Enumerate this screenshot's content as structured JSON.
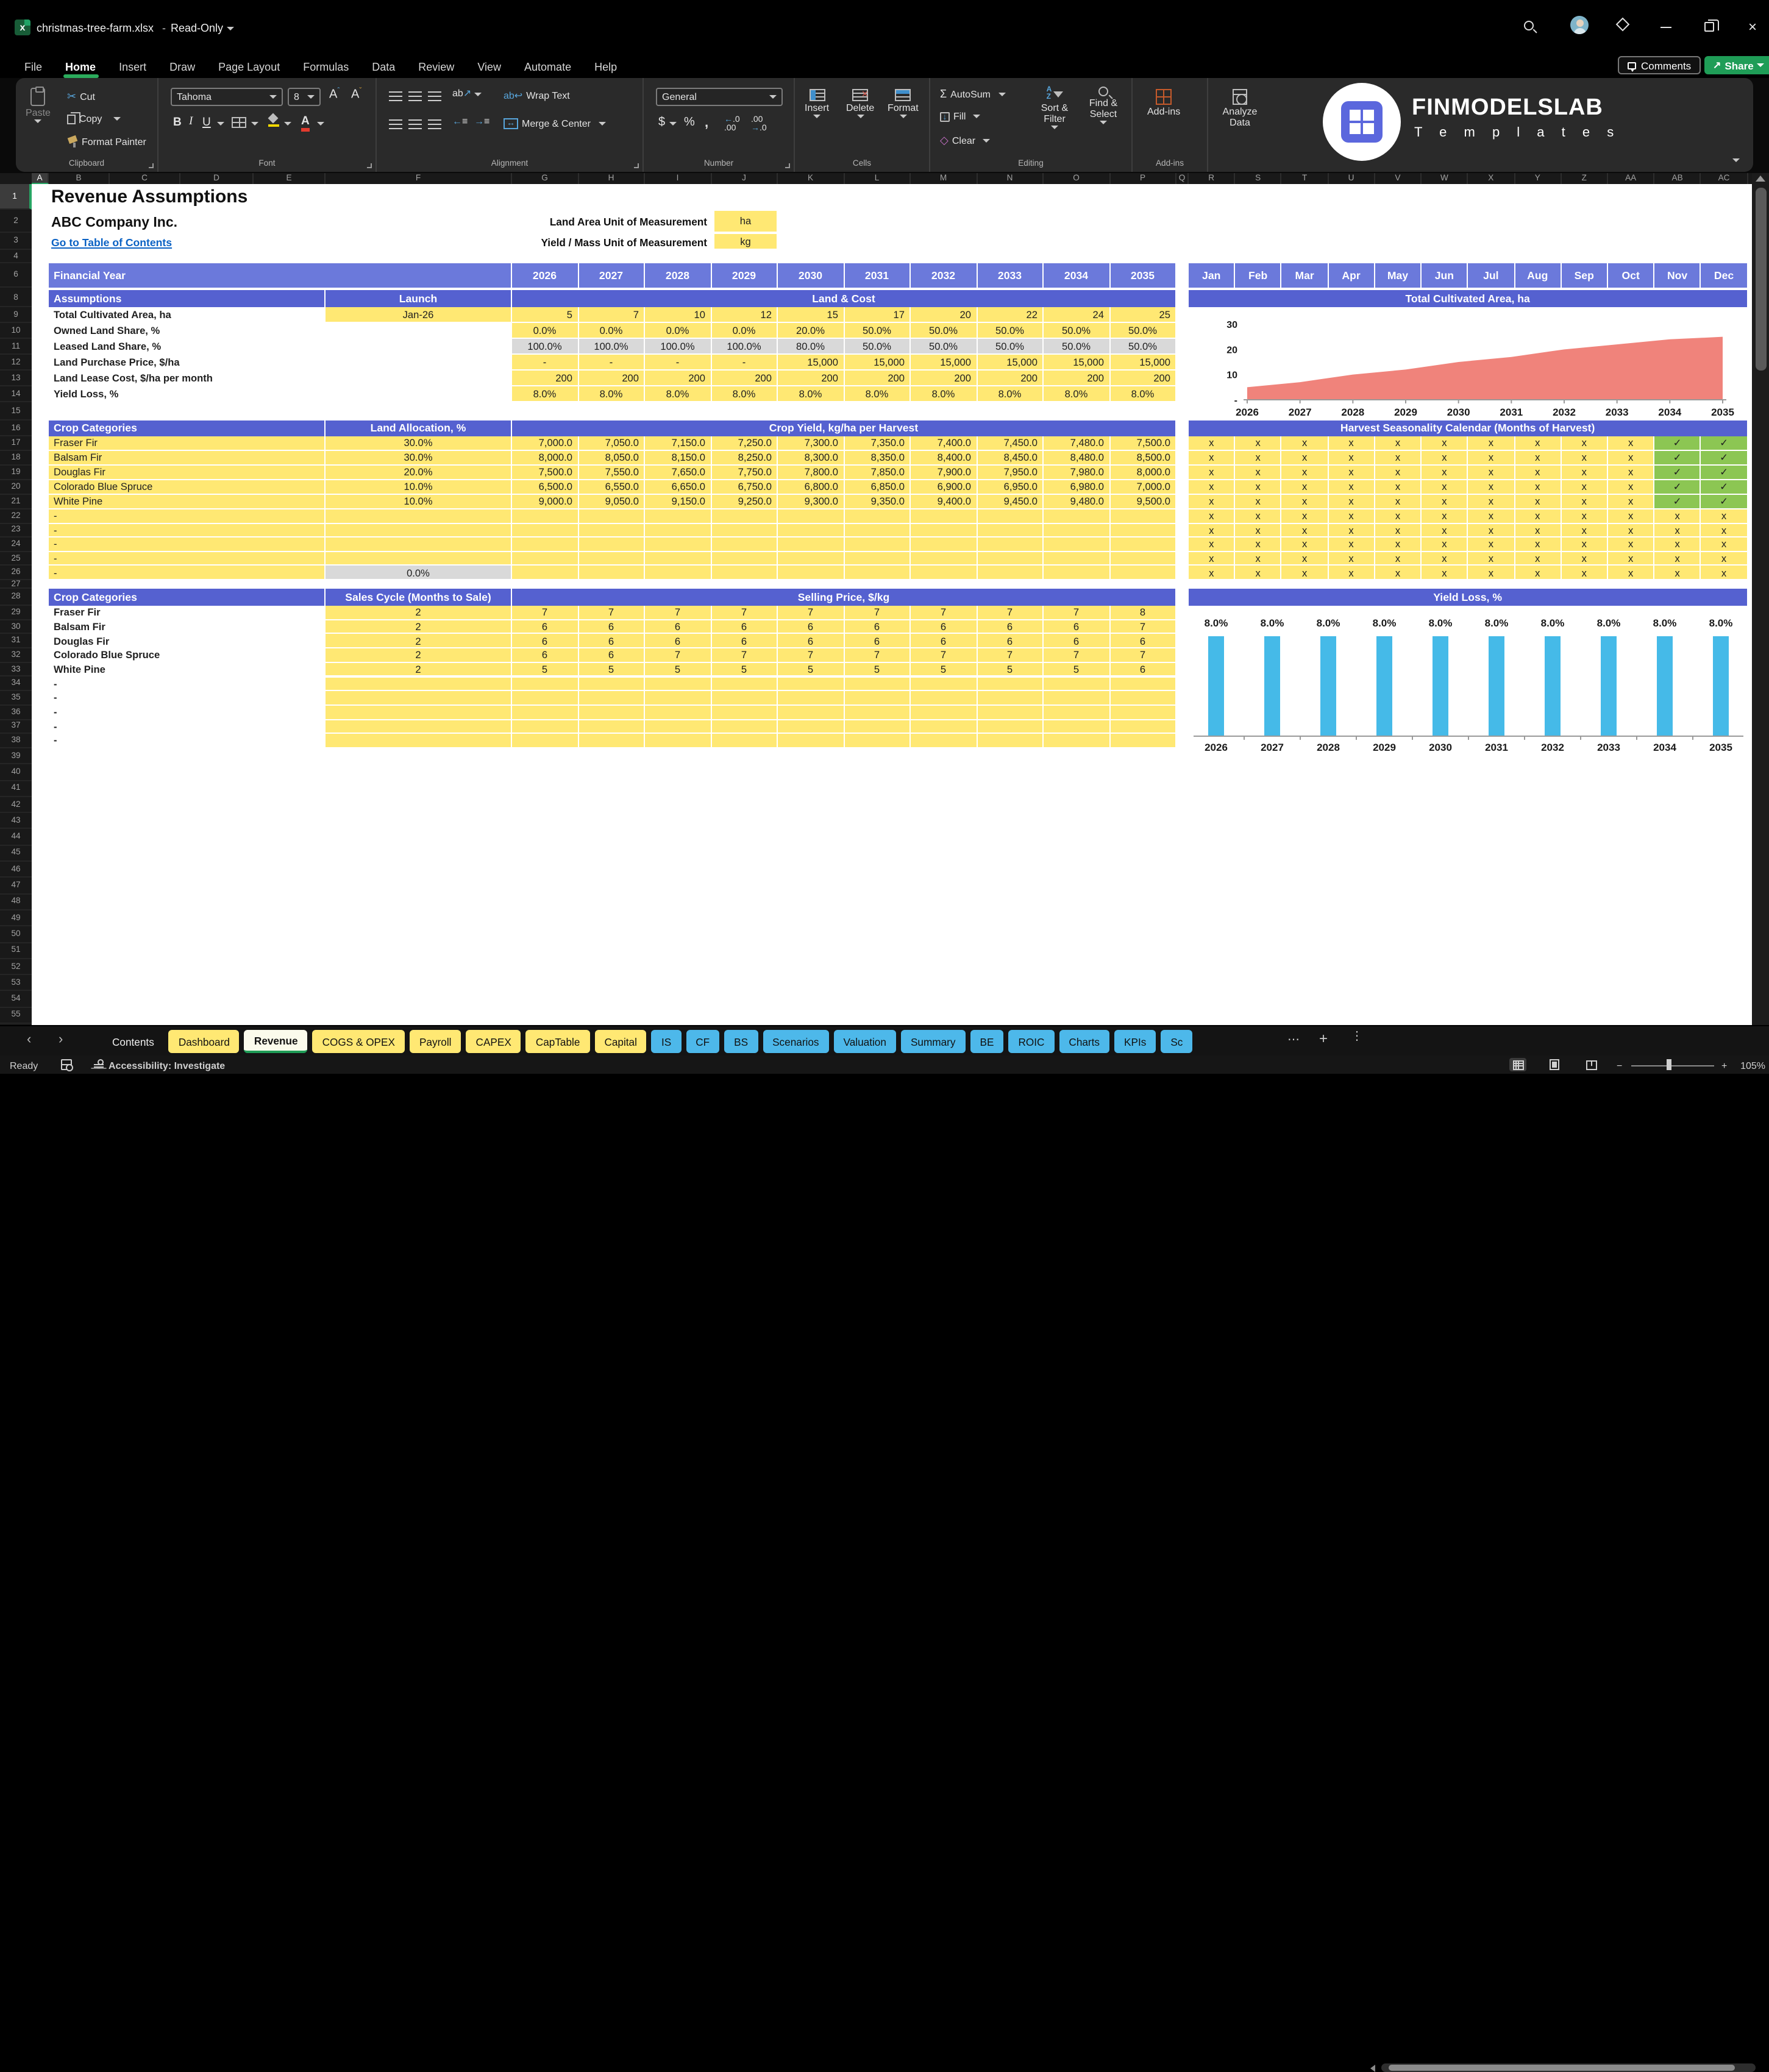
{
  "titlebar": {
    "file": "christmas-tree-farm.xlsx",
    "sep": "-",
    "mode": "Read-Only"
  },
  "topbar": {
    "comments": "Comments",
    "share": "Share"
  },
  "menu": [
    "File",
    "Home",
    "Insert",
    "Draw",
    "Page Layout",
    "Formulas",
    "Data",
    "Review",
    "View",
    "Automate",
    "Help"
  ],
  "active_menu": "Home",
  "ribbon": {
    "paste": "Paste",
    "cut": "Cut",
    "copy": "Copy",
    "format_painter": "Format Painter",
    "clipboard": "Clipboard",
    "font_name": "Tahoma",
    "font_size": "8",
    "font": "Font",
    "wrap_text": "Wrap Text",
    "merge_center": "Merge & Center",
    "alignment": "Alignment",
    "number_format": "General",
    "number": "Number",
    "insert": "Insert",
    "delete": "Delete",
    "format": "Format",
    "cells": "Cells",
    "autosum": "AutoSum",
    "fill": "Fill",
    "clear": "Clear",
    "sort_filter": "Sort & Filter",
    "find_select": "Find & Select",
    "editing": "Editing",
    "addins": "Add-ins",
    "addins_group": "Add-ins",
    "analyze_data": "Analyze Data"
  },
  "logo": {
    "name": "FINMODELSLAB",
    "sub": "T e m p l a t e s"
  },
  "grid": {
    "columns": [
      "A",
      "B",
      "C",
      "D",
      "E",
      "F",
      "G",
      "H",
      "I",
      "J",
      "K",
      "L",
      "M",
      "N",
      "O",
      "P",
      "Q",
      "R",
      "S",
      "T",
      "U",
      "V",
      "W",
      "X",
      "Y",
      "Z",
      "AA",
      "AB",
      "AC"
    ],
    "rows": [
      "1",
      "2",
      "3",
      "4",
      "6",
      "8",
      "9",
      "10",
      "11",
      "12",
      "13",
      "14",
      "15",
      "16",
      "17",
      "18",
      "19",
      "20",
      "21",
      "22",
      "23",
      "24",
      "25",
      "26",
      "27",
      "28",
      "29",
      "30",
      "31",
      "32",
      "33",
      "34",
      "35",
      "36",
      "37",
      "38",
      "39",
      "40",
      "41",
      "42",
      "43",
      "44",
      "45",
      "46",
      "47",
      "48",
      "49",
      "50",
      "51",
      "52",
      "53",
      "54",
      "55"
    ]
  },
  "sheet": {
    "title": "Revenue Assumptions",
    "company": "ABC Company Inc.",
    "toc_link": "Go to Table of Contents",
    "uom": [
      {
        "label": "Land Area Unit of Measurement",
        "value": "ha"
      },
      {
        "label": "Yield / Mass Unit of Measurement",
        "value": "kg"
      }
    ],
    "financial_year": {
      "label": "Financial Year",
      "years": [
        "2026",
        "2027",
        "2028",
        "2029",
        "2030",
        "2031",
        "2032",
        "2033",
        "2034",
        "2035"
      ]
    },
    "months": [
      "Jan",
      "Feb",
      "Mar",
      "Apr",
      "May",
      "Jun",
      "Jul",
      "Aug",
      "Sep",
      "Oct",
      "Nov",
      "Dec"
    ],
    "assumptions": {
      "title": "Assumptions",
      "launch": "Launch",
      "group": "Land & Cost",
      "rows": [
        {
          "label": "Total Cultivated Area, ha",
          "launch": "Jan-26",
          "align": "right",
          "values": [
            "5",
            "7",
            "10",
            "12",
            "15",
            "17",
            "20",
            "22",
            "24",
            "25"
          ]
        },
        {
          "label": "Owned Land Share, %",
          "align": "center",
          "values": [
            "0.0%",
            "0.0%",
            "0.0%",
            "0.0%",
            "20.0%",
            "50.0%",
            "50.0%",
            "50.0%",
            "50.0%",
            "50.0%"
          ]
        },
        {
          "label": "Leased Land Share, %",
          "align": "center",
          "grey": true,
          "values": [
            "100.0%",
            "100.0%",
            "100.0%",
            "100.0%",
            "80.0%",
            "50.0%",
            "50.0%",
            "50.0%",
            "50.0%",
            "50.0%"
          ]
        },
        {
          "label": "Land Purchase Price, $/ha",
          "align": "right",
          "values": [
            "-",
            "-",
            "-",
            "-",
            "15,000",
            "15,000",
            "15,000",
            "15,000",
            "15,000",
            "15,000"
          ]
        },
        {
          "label": "Land Lease Cost, $/ha per month",
          "align": "right",
          "values": [
            "200",
            "200",
            "200",
            "200",
            "200",
            "200",
            "200",
            "200",
            "200",
            "200"
          ]
        },
        {
          "label": "Yield Loss, %",
          "align": "center",
          "values": [
            "8.0%",
            "8.0%",
            "8.0%",
            "8.0%",
            "8.0%",
            "8.0%",
            "8.0%",
            "8.0%",
            "8.0%",
            "8.0%"
          ]
        }
      ]
    },
    "crop_yield": {
      "title": "Crop Categories",
      "col2": "Land Allocation, %",
      "group": "Crop Yield, kg/ha per Harvest",
      "rows": [
        {
          "label": "Fraser Fir",
          "col2": "30.0%",
          "values": [
            "7,000.0",
            "7,050.0",
            "7,150.0",
            "7,250.0",
            "7,300.0",
            "7,350.0",
            "7,400.0",
            "7,450.0",
            "7,480.0",
            "7,500.0"
          ]
        },
        {
          "label": "Balsam Fir",
          "col2": "30.0%",
          "values": [
            "8,000.0",
            "8,050.0",
            "8,150.0",
            "8,250.0",
            "8,300.0",
            "8,350.0",
            "8,400.0",
            "8,450.0",
            "8,480.0",
            "8,500.0"
          ]
        },
        {
          "label": "Douglas Fir",
          "col2": "20.0%",
          "values": [
            "7,500.0",
            "7,550.0",
            "7,650.0",
            "7,750.0",
            "7,800.0",
            "7,850.0",
            "7,900.0",
            "7,950.0",
            "7,980.0",
            "8,000.0"
          ]
        },
        {
          "label": "Colorado Blue Spruce",
          "col2": "10.0%",
          "values": [
            "6,500.0",
            "6,550.0",
            "6,650.0",
            "6,750.0",
            "6,800.0",
            "6,850.0",
            "6,900.0",
            "6,950.0",
            "6,980.0",
            "7,000.0"
          ]
        },
        {
          "label": "White Pine",
          "col2": "10.0%",
          "values": [
            "9,000.0",
            "9,050.0",
            "9,150.0",
            "9,250.0",
            "9,300.0",
            "9,350.0",
            "9,400.0",
            "9,450.0",
            "9,480.0",
            "9,500.0"
          ]
        },
        {
          "label": "-",
          "col2": "",
          "values": [
            "",
            "",
            "",
            "",
            "",
            "",
            "",
            "",
            "",
            ""
          ]
        },
        {
          "label": "-",
          "col2": "",
          "values": [
            "",
            "",
            "",
            "",
            "",
            "",
            "",
            "",
            "",
            ""
          ]
        },
        {
          "label": "-",
          "col2": "",
          "values": [
            "",
            "",
            "",
            "",
            "",
            "",
            "",
            "",
            "",
            ""
          ]
        },
        {
          "label": "-",
          "col2": "",
          "values": [
            "",
            "",
            "",
            "",
            "",
            "",
            "",
            "",
            "",
            ""
          ]
        },
        {
          "label": "-",
          "col2": "0.0%",
          "col2_grey": true,
          "values": [
            "",
            "",
            "",
            "",
            "",
            "",
            "",
            "",
            "",
            ""
          ]
        }
      ]
    },
    "selling": {
      "title": "Crop Categories",
      "col2": "Sales Cycle (Months to Sale)",
      "group": "Selling Price, $/kg",
      "rows": [
        {
          "label": "Fraser Fir",
          "col2": "2",
          "values": [
            "7",
            "7",
            "7",
            "7",
            "7",
            "7",
            "7",
            "7",
            "7",
            "8"
          ]
        },
        {
          "label": "Balsam Fir",
          "col2": "2",
          "values": [
            "6",
            "6",
            "6",
            "6",
            "6",
            "6",
            "6",
            "6",
            "6",
            "7"
          ]
        },
        {
          "label": "Douglas Fir",
          "col2": "2",
          "values": [
            "6",
            "6",
            "6",
            "6",
            "6",
            "6",
            "6",
            "6",
            "6",
            "6"
          ]
        },
        {
          "label": "Colorado Blue Spruce",
          "col2": "2",
          "values": [
            "6",
            "6",
            "7",
            "7",
            "7",
            "7",
            "7",
            "7",
            "7",
            "7"
          ]
        },
        {
          "label": "White Pine",
          "col2": "2",
          "values": [
            "5",
            "5",
            "5",
            "5",
            "5",
            "5",
            "5",
            "5",
            "5",
            "6"
          ]
        },
        {
          "label": "-",
          "col2": "",
          "values": [
            "",
            "",
            "",
            "",
            "",
            "",
            "",
            "",
            "",
            ""
          ]
        },
        {
          "label": "-",
          "col2": "",
          "values": [
            "",
            "",
            "",
            "",
            "",
            "",
            "",
            "",
            "",
            ""
          ]
        },
        {
          "label": "-",
          "col2": "",
          "values": [
            "",
            "",
            "",
            "",
            "",
            "",
            "",
            "",
            "",
            ""
          ]
        },
        {
          "label": "-",
          "col2": "",
          "values": [
            "",
            "",
            "",
            "",
            "",
            "",
            "",
            "",
            "",
            ""
          ]
        },
        {
          "label": "-",
          "col2": "",
          "values": [
            "",
            "",
            "",
            "",
            "",
            "",
            "",
            "",
            "",
            ""
          ]
        }
      ]
    },
    "calendar": {
      "title": "Harvest Seasonality Calendar (Months of Harvest)",
      "rows": [
        [
          "x",
          "x",
          "x",
          "x",
          "x",
          "x",
          "x",
          "x",
          "x",
          "x",
          "✓",
          "✓"
        ],
        [
          "x",
          "x",
          "x",
          "x",
          "x",
          "x",
          "x",
          "x",
          "x",
          "x",
          "✓",
          "✓"
        ],
        [
          "x",
          "x",
          "x",
          "x",
          "x",
          "x",
          "x",
          "x",
          "x",
          "x",
          "✓",
          "✓"
        ],
        [
          "x",
          "x",
          "x",
          "x",
          "x",
          "x",
          "x",
          "x",
          "x",
          "x",
          "✓",
          "✓"
        ],
        [
          "x",
          "x",
          "x",
          "x",
          "x",
          "x",
          "x",
          "x",
          "x",
          "x",
          "✓",
          "✓"
        ],
        [
          "x",
          "x",
          "x",
          "x",
          "x",
          "x",
          "x",
          "x",
          "x",
          "x",
          "x",
          "x"
        ],
        [
          "x",
          "x",
          "x",
          "x",
          "x",
          "x",
          "x",
          "x",
          "x",
          "x",
          "x",
          "x"
        ],
        [
          "x",
          "x",
          "x",
          "x",
          "x",
          "x",
          "x",
          "x",
          "x",
          "x",
          "x",
          "x"
        ],
        [
          "x",
          "x",
          "x",
          "x",
          "x",
          "x",
          "x",
          "x",
          "x",
          "x",
          "x",
          "x"
        ],
        [
          "x",
          "x",
          "x",
          "x",
          "x",
          "x",
          "x",
          "x",
          "x",
          "x",
          "x",
          "x"
        ]
      ]
    }
  },
  "chart_data": [
    {
      "type": "area",
      "title": "Total Cultivated Area, ha",
      "x": [
        "2026",
        "2027",
        "2028",
        "2029",
        "2030",
        "2031",
        "2032",
        "2033",
        "2034",
        "2035"
      ],
      "values": [
        5,
        7,
        10,
        12,
        15,
        17,
        20,
        22,
        24,
        25
      ],
      "ylim": [
        0,
        30
      ],
      "yticks": [
        {
          "label": "30",
          "value": 30
        },
        {
          "label": "20",
          "value": 20
        },
        {
          "label": "10",
          "value": 10
        },
        {
          "label": "-",
          "value": 0
        }
      ],
      "color": "#F0837B",
      "legend": "none",
      "grid": "off"
    },
    {
      "type": "bar",
      "title": "Yield Loss, %",
      "categories": [
        "2026",
        "2027",
        "2028",
        "2029",
        "2030",
        "2031",
        "2032",
        "2033",
        "2034",
        "2035"
      ],
      "values": [
        8,
        8,
        8,
        8,
        8,
        8,
        8,
        8,
        8,
        8
      ],
      "bar_labels": [
        "8.0%",
        "8.0%",
        "8.0%",
        "8.0%",
        "8.0%",
        "8.0%",
        "8.0%",
        "8.0%",
        "8.0%",
        "8.0%"
      ],
      "ylim": [
        0,
        10
      ],
      "color": "#45BAE8",
      "legend": "none",
      "grid": "off"
    }
  ],
  "tabs": {
    "items": [
      {
        "label": "Contents",
        "style": "dark"
      },
      {
        "label": "Dashboard",
        "style": "yellow"
      },
      {
        "label": "Revenue",
        "style": "active"
      },
      {
        "label": "COGS & OPEX",
        "style": "yellow"
      },
      {
        "label": "Payroll",
        "style": "yellow"
      },
      {
        "label": "CAPEX",
        "style": "yellow"
      },
      {
        "label": "CapTable",
        "style": "yellow"
      },
      {
        "label": "Capital",
        "style": "yellow"
      },
      {
        "label": "IS",
        "style": "blue"
      },
      {
        "label": "CF",
        "style": "blue"
      },
      {
        "label": "BS",
        "style": "blue"
      },
      {
        "label": "Scenarios",
        "style": "blue"
      },
      {
        "label": "Valuation",
        "style": "blue"
      },
      {
        "label": "Summary",
        "style": "blue"
      },
      {
        "label": "BE",
        "style": "blue"
      },
      {
        "label": "ROIC",
        "style": "blue"
      },
      {
        "label": "Charts",
        "style": "blue"
      },
      {
        "label": "KPIs",
        "style": "blue"
      },
      {
        "label": "Sc",
        "style": "blue"
      }
    ]
  },
  "statusbar": {
    "ready": "Ready",
    "accessibility": "Accessibility: Investigate",
    "zoom": "105%"
  }
}
